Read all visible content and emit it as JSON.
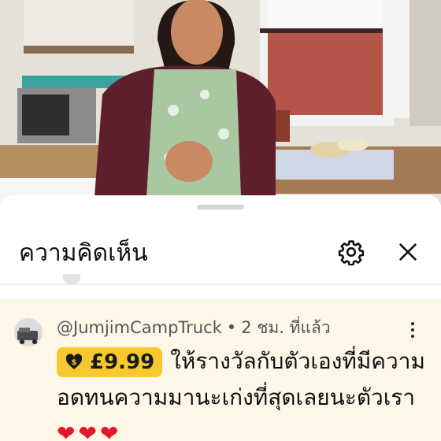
{
  "comments_panel": {
    "title": "ความคิดเห็น",
    "settings_icon": "gear-icon",
    "close_icon": "close-icon"
  },
  "comment": {
    "username": "@JumjimCampTruck",
    "separator": "•",
    "time": "2 ชม. ที่แล้ว",
    "super_thanks_amount": "£9.99",
    "text": "ให้รางวัลกับตัวเองที่มีความอดทนความมานะเก่งที่สุดเลยนะตัวเรา",
    "hearts": "❤❤❤",
    "colors": {
      "badge": "#f8c92e",
      "highlight_bg": "#fdf7e7",
      "heart": "#e3172b"
    }
  }
}
